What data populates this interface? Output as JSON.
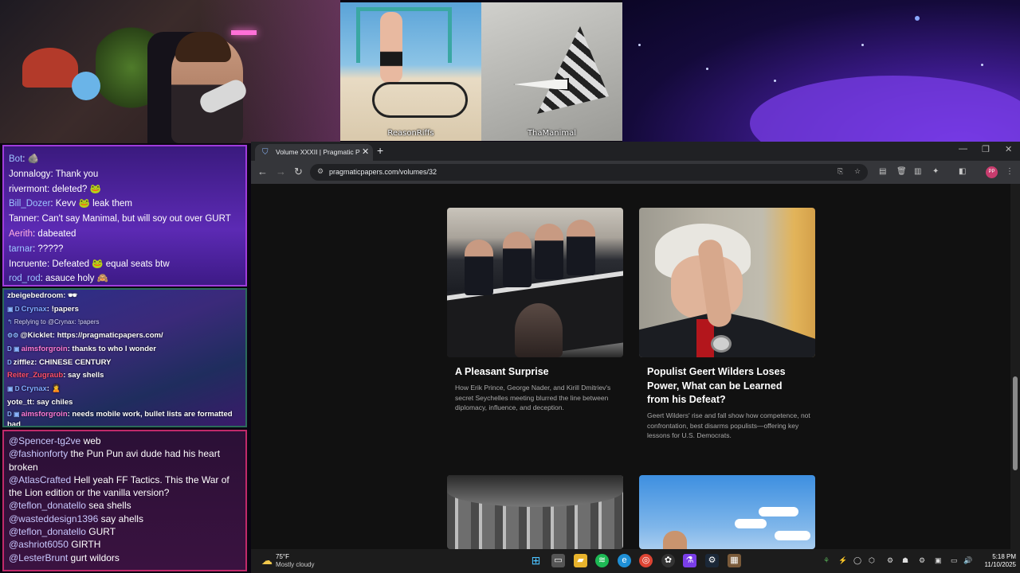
{
  "overlay": {
    "clip1_label": "ReasonRiffs",
    "clip2_label": "ThaManimal"
  },
  "chat_top": [
    {
      "user": "Bot",
      "color": "#9ec5ff",
      "text": ": 🪨"
    },
    {
      "user": "Jonnalogy",
      "color": "#ffffff",
      "text": ": Thank you"
    },
    {
      "user": "rivermont",
      "color": "#ffffff",
      "text": ": deleted? 🐸"
    },
    {
      "user": "Bill_Dozer",
      "color": "#9ec5ff",
      "text": ": Kevv 🐸 leak them"
    },
    {
      "user": "Tanner",
      "color": "#ffffff",
      "text": ": Can't say Manimal, but will soy out over GURT"
    },
    {
      "user": "Aerith",
      "color": "#ffb0e0",
      "text": ": dabeated"
    },
    {
      "user": "tarnar",
      "color": "#9ec5ff",
      "text": ": ?????"
    },
    {
      "user": "Incruente",
      "color": "#ffffff",
      "text": ": Defeated 🐸 equal seats btw"
    },
    {
      "user": "rod_rod",
      "color": "#9ec5ff",
      "text": ": asauce holy 🙈"
    }
  ],
  "chat_mid": [
    {
      "pre": "",
      "user": "zbeigebedroom",
      "color": "#ffffff",
      "text": ": 🕶"
    },
    {
      "pre": "▣ D",
      "user": "Crynax",
      "color": "#7fa8ff",
      "text": ": !papers"
    },
    {
      "pre": "↰",
      "user": "",
      "color": "#ffffff",
      "text": "Replying to @Crynax: !papers",
      "reply": true
    },
    {
      "pre": "⚙⚙",
      "user": "@Kicklet",
      "color": "#ffffff",
      "text": ": https://pragmaticpapers.com/"
    },
    {
      "pre": "D ▣",
      "user": "aimsforgroin",
      "color": "#ff7ad8",
      "text": ": thanks to who I wonder"
    },
    {
      "pre": "D",
      "user": "zifflez",
      "color": "#ffffff",
      "text": ": CHINESE CENTURY"
    },
    {
      "pre": "",
      "user": "Reiter_Zugraub",
      "color": "#ff4f6a",
      "text": ": say shells"
    },
    {
      "pre": "▣ D",
      "user": "Crynax",
      "color": "#7fa8ff",
      "text": ": 🙎"
    },
    {
      "pre": "",
      "user": "yote_tt",
      "color": "#ffffff",
      "text": ": say chiles"
    },
    {
      "pre": "D ▣",
      "user": "aimsforgroin",
      "color": "#ff7ad8",
      "text": ": needs mobile work, bullet lists are formatted bad",
      "wrap": true
    }
  ],
  "chat_bottom": [
    {
      "user": "@Spencer-tg2ve",
      "text": " web"
    },
    {
      "user": "@fashionforty",
      "text": " the Pun Pun avi dude had his heart broken"
    },
    {
      "user": "@AtlasCrafted",
      "text": " Hell yeah FF Tactics. This the War of the Lion edition or the vanilla version?"
    },
    {
      "user": "@teflon_donatello",
      "text": " sea shells"
    },
    {
      "user": "@wasteddesign1396",
      "text": " say ahells"
    },
    {
      "user": "@teflon_donatello",
      "text": " GURT"
    },
    {
      "user": "@ashriot6050",
      "text": " GIRTH"
    },
    {
      "user": "@LesterBrunt",
      "text": " gurt wildors"
    }
  ],
  "browser": {
    "tab_title": "Volume XXXII | Pragmatic Papers",
    "tab_close": "✕",
    "new_tab": "+",
    "url": "pragmaticpapers.com/volumes/32",
    "avatar_initials": "PP"
  },
  "articles": [
    {
      "title": "A Pleasant Surprise",
      "desc": "How Erik Prince, George Nader, and Kirill Dmitriev's secret Seychelles meeting blurred the line between diplomacy, influence, and deception."
    },
    {
      "title": "Populist Geert Wilders Loses Power, What can be Learned from his Defeat?",
      "desc": "Geert Wilders' rise and fall show how competence, not confrontation, best disarms populists—offering key lessons for U.S. Democrats."
    }
  ],
  "taskbar": {
    "temp": "75°F",
    "weather": "Mostly cloudy",
    "time": "5:18 PM",
    "date": "11/10/2025"
  },
  "colors": {
    "chat_top_bg": "#4a2298",
    "chat_mid_border": "#2b6b5a",
    "chat_bottom_border": "#c02a6a",
    "browser_chrome": "#35363a",
    "page_bg": "#111111"
  }
}
